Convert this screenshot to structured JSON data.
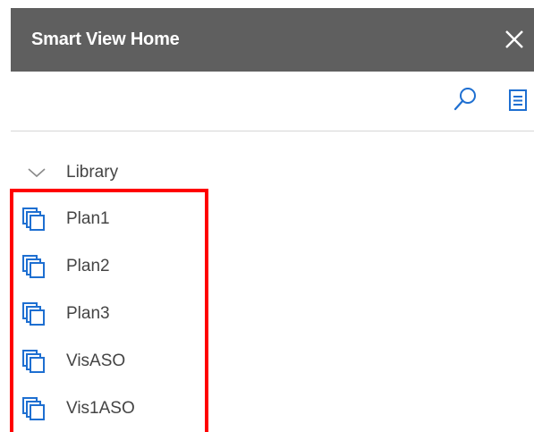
{
  "panel": {
    "title": "Smart View Home"
  },
  "icons": {
    "close": "close-icon",
    "search": "search-icon",
    "menu": "list-menu-icon",
    "chevron": "chevron-down-icon",
    "cube": "cube-stack-icon"
  },
  "library": {
    "label": "Library",
    "expanded": true,
    "items": [
      {
        "label": "Plan1"
      },
      {
        "label": "Plan2"
      },
      {
        "label": "Plan3"
      },
      {
        "label": "VisASO"
      },
      {
        "label": "Vis1ASO"
      }
    ]
  },
  "colors": {
    "titlebar": "#5f5f5f",
    "accent": "#1e6fd1",
    "highlight": "#ff0000",
    "text": "#444444"
  }
}
